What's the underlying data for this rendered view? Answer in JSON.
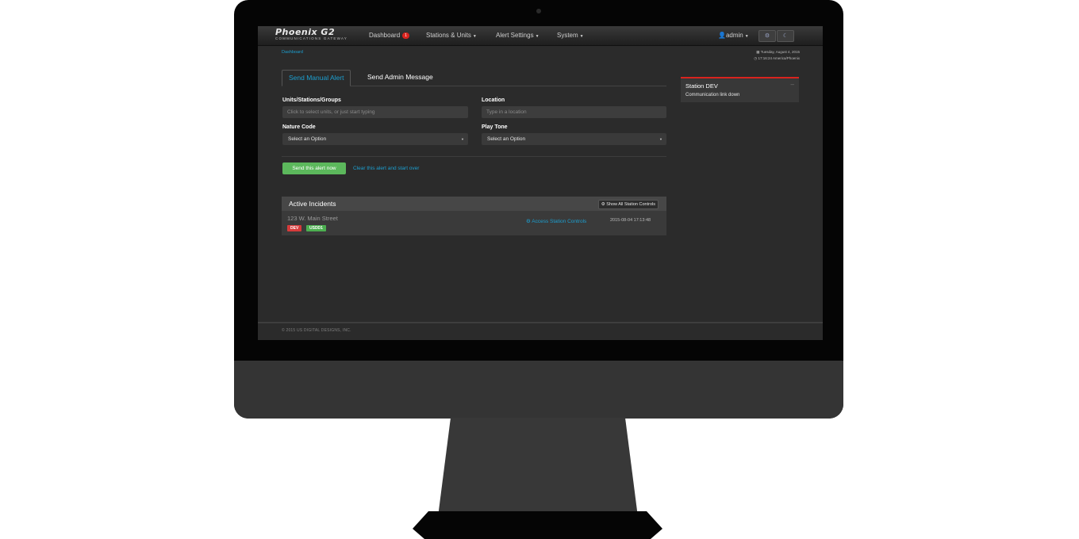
{
  "app": {
    "logo_title": "Phoenix G2",
    "logo_subtitle": "COMMUNICATIONS GATEWAY"
  },
  "nav": {
    "dashboard": {
      "label": "Dashboard",
      "badge": "1"
    },
    "stations_units": "Stations & Units",
    "alert_settings": "Alert Settings",
    "system": "System",
    "user": "admin"
  },
  "breadcrumb": "Dashboard",
  "datetime": {
    "date": "Tuesday, August 4, 2015",
    "time": "17:16:24 America/Phoenix"
  },
  "tabs": [
    {
      "label": "Send Manual Alert",
      "active": true
    },
    {
      "label": "Send Admin Message",
      "active": false
    }
  ],
  "form": {
    "units_label": "Units/Stations/Groups",
    "units_placeholder": "Click to select units, or just start typing",
    "location_label": "Location",
    "location_placeholder": "Type in a location",
    "nature_label": "Nature Code",
    "nature_value": "Select an Option",
    "tone_label": "Play Tone",
    "tone_value": "Select an Option",
    "send_button": "Send this alert now",
    "clear_link": "Clear this alert and start over"
  },
  "incidents": {
    "title": "Active Incidents",
    "show_all_button": "Show All Station Controls",
    "items": [
      {
        "address": "123 W. Main Street",
        "access_link": "Access Station Controls",
        "timestamp": "2015-08-04 17:13:48",
        "labels": [
          "DEV",
          "USDD1"
        ]
      }
    ]
  },
  "station_alert": {
    "title": "Station DEV",
    "message": "Communication link down"
  },
  "footer": "© 2015 US DIGITAL DESIGNS, INC.",
  "colors": {
    "accent": "#1c9fd0",
    "badge": "#d9231e",
    "send_button": "#5cb85c",
    "label_red": "#d63b3b",
    "label_green": "#4caf50"
  },
  "icons": [
    "user-icon",
    "gear-icon",
    "moon-icon",
    "calendar-icon",
    "clock-icon",
    "controls-icon",
    "close-icon",
    "caret-down-icon"
  ]
}
